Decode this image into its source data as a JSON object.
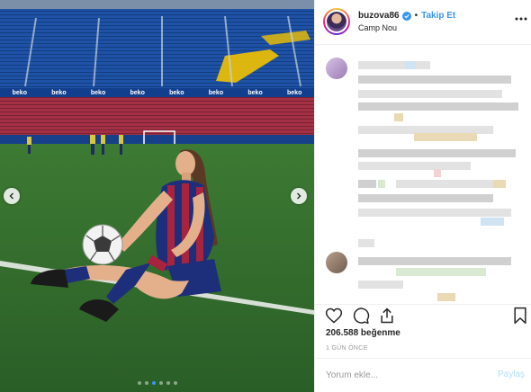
{
  "post": {
    "username": "buzova86",
    "separator": "•",
    "follow_label": "Takip Et",
    "location": "Camp Nou",
    "likes": "206.588 beğenme",
    "time_ago": "1 GÜN ÖNCE"
  },
  "photo": {
    "banner_texts": [
      "beko",
      "beko",
      "beko",
      "beko",
      "beko",
      "beko",
      "beko",
      "beko"
    ],
    "carousel": {
      "count": 6,
      "active": 2
    }
  },
  "comment_box": {
    "placeholder": "Yorum ekle...",
    "post_label": "Paylaş"
  },
  "icons": {
    "verified": "verified-badge-icon",
    "more": "more-options-icon",
    "like": "heart-icon",
    "comment": "comment-icon",
    "share": "share-icon",
    "save": "bookmark-icon",
    "prev": "chevron-left-icon",
    "next": "chevron-right-icon"
  },
  "colors": {
    "accent": "#3897f0",
    "pitch": "#2f6a2c",
    "stands": "#1c4e9e",
    "text": "#262626",
    "muted": "#999999"
  }
}
